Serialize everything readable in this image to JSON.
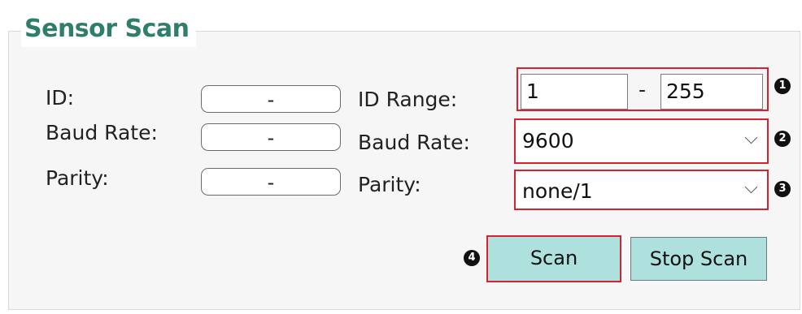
{
  "group": {
    "title": "Sensor Scan"
  },
  "left": {
    "id_label": "ID:",
    "baud_label": "Baud Rate:",
    "parity_label": "Parity:",
    "id_value": "-",
    "baud_value": "-",
    "parity_value": "-"
  },
  "right": {
    "id_range_label": "ID Range:",
    "id_range_from": "1",
    "id_range_sep": "-",
    "id_range_to": "255",
    "baud_label": "Baud Rate:",
    "baud_value": "9600",
    "parity_label": "Parity:",
    "parity_value": "none/1"
  },
  "buttons": {
    "scan": "Scan",
    "stop_scan": "Stop Scan"
  },
  "callouts": [
    "1",
    "2",
    "3",
    "4"
  ],
  "colors": {
    "title": "#2f7d6b",
    "highlight": "#d7212f",
    "button_fill": "#aee0de"
  },
  "icons": {
    "dropdown": "chevron-down-icon"
  }
}
